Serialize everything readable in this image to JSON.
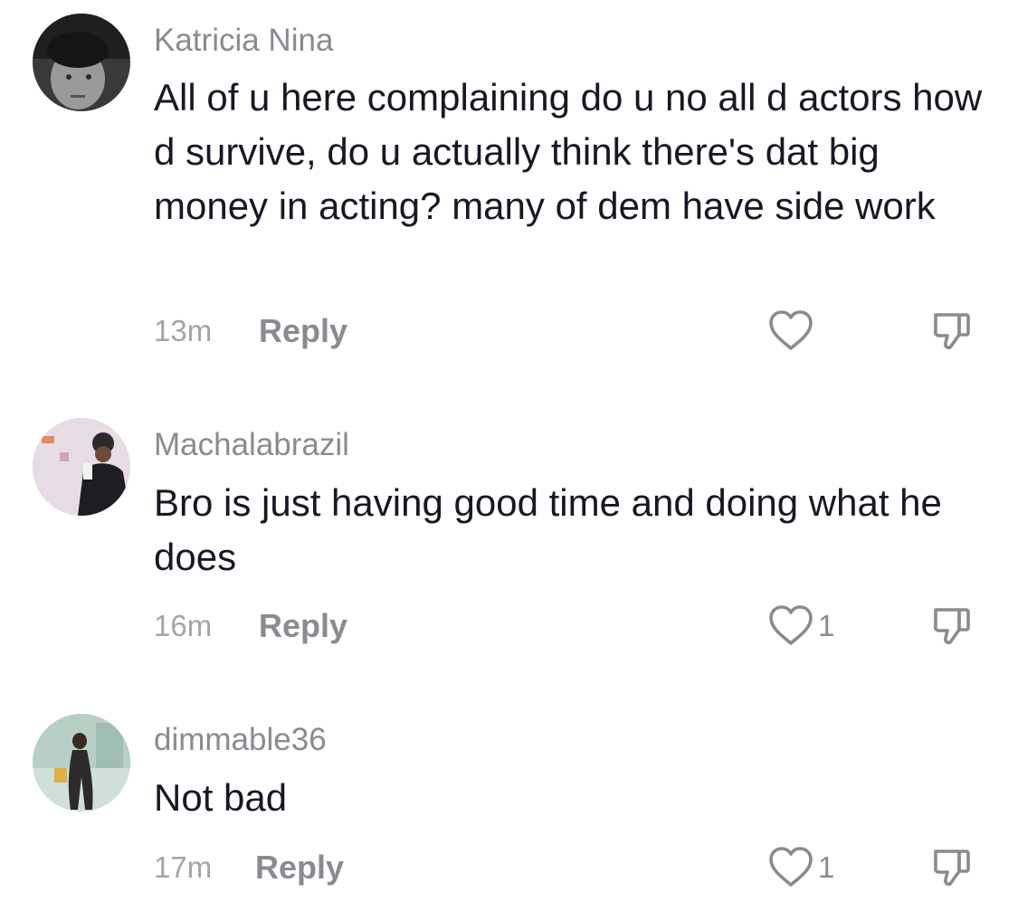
{
  "comments": [
    {
      "username": "Katricia Nina",
      "text": "All of u here complaining do u no all d actors how d survive, do u actually think there's dat big money in acting? many of dem have side work",
      "time": "13m",
      "reply_label": "Reply",
      "like_count": "",
      "avatar_icon": "avatar-photo-icon"
    },
    {
      "username": "Machalabrazil",
      "text": "Bro is just having good time and doing what he does",
      "time": "16m",
      "reply_label": "Reply",
      "like_count": "1",
      "avatar_icon": "avatar-photo-icon"
    },
    {
      "username": "dimmable36",
      "text": "Not bad",
      "time": "17m",
      "reply_label": "Reply",
      "like_count": "1",
      "avatar_icon": "avatar-photo-icon"
    }
  ],
  "icons": {
    "like": "heart-outline-icon",
    "dislike": "thumbs-down-icon"
  },
  "colors": {
    "text": "#161823",
    "secondary": "#8a8b91",
    "timestamp": "#a3a4a8",
    "background": "#ffffff"
  }
}
